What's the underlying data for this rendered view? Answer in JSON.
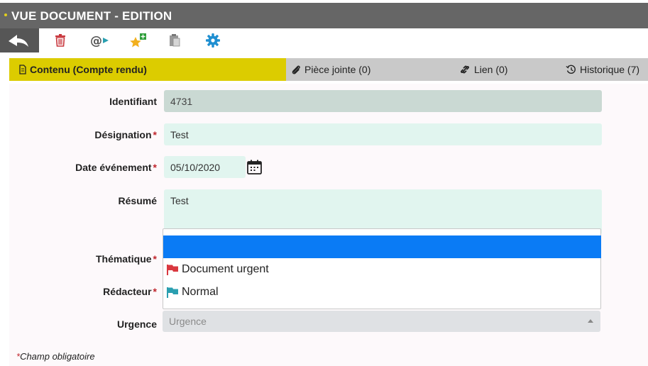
{
  "window": {
    "title": "VUE DOCUMENT - EDITION"
  },
  "toolbar": {
    "icons": [
      "back-arrow-icon",
      "trash-icon",
      "email-forward-icon",
      "star-add-icon",
      "clipboard-icon",
      "gear-icon"
    ]
  },
  "tabs": [
    {
      "label": "Contenu (Compte rendu)",
      "icon": "document-icon",
      "active": true
    },
    {
      "label": "Pièce jointe (0)",
      "icon": "paperclip-icon",
      "active": false
    },
    {
      "label": "Lien (0)",
      "icon": "link-icon",
      "active": false
    },
    {
      "label": "Historique (7)",
      "icon": "history-icon",
      "active": false
    }
  ],
  "form": {
    "identifiant": {
      "label": "Identifiant",
      "value": "4731"
    },
    "designation": {
      "label": "Désignation",
      "value": "Test",
      "required": "*"
    },
    "date": {
      "label": "Date événement",
      "value": "05/10/2020",
      "required": "*"
    },
    "resume": {
      "label": "Résumé",
      "value": "Test"
    },
    "thematique": {
      "label": "Thématique",
      "required": "*"
    },
    "redacteur": {
      "label": "Rédacteur",
      "required": "*"
    },
    "urgence": {
      "label": "Urgence",
      "placeholder": "Urgence"
    }
  },
  "dropdown": {
    "options": [
      {
        "label": "",
        "highlighted": true
      },
      {
        "label": "Document urgent",
        "flag_color": "#d9383f"
      },
      {
        "label": "Normal",
        "flag_color": "#2a9fb0"
      }
    ]
  },
  "footer": {
    "required_mark": "*",
    "note": "Champ obligatoire"
  },
  "colors": {
    "accent_tab": "#dccc00",
    "highlight": "#0a7bf5",
    "required": "#c0262d"
  }
}
